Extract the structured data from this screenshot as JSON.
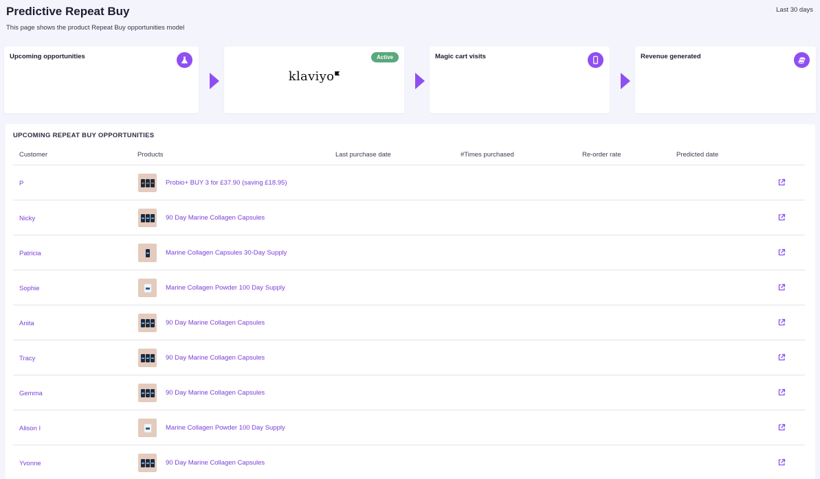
{
  "header": {
    "title": "Predictive Repeat Buy",
    "subtitle": "This page shows the product Repeat Buy opportunities model",
    "date_range": "Last 30 days"
  },
  "cards": [
    {
      "label": "Upcoming opportunities",
      "icon": "flask-icon"
    },
    {
      "logo": "klaviyo",
      "status": "Active",
      "status_color": "#5aa87c"
    },
    {
      "label": "Magic cart visits",
      "icon": "mobile-icon"
    },
    {
      "label": "Revenue generated",
      "icon": "coins-icon"
    }
  ],
  "accent_color": "#8f4ff0",
  "table": {
    "title": "UPCOMING REPEAT BUY OPPORTUNITIES",
    "columns": [
      "Customer",
      "Products",
      "Last purchase date",
      "#Times purchased",
      "Re-order rate",
      "Predicted date"
    ],
    "rows": [
      {
        "customer": "P",
        "product": "Probio+ BUY 3 for £37.90 (saving £18.95)",
        "thumb": "three-dark-jars"
      },
      {
        "customer": "Nicky",
        "product": "90 Day Marine Collagen Capsules",
        "thumb": "three-jars"
      },
      {
        "customer": "Patricia",
        "product": "Marine Collagen Capsules 30-Day Supply",
        "thumb": "single-jar"
      },
      {
        "customer": "Sophie",
        "product": "Marine Collagen Powder 100 Day Supply",
        "thumb": "tub"
      },
      {
        "customer": "Anita",
        "product": "90 Day Marine Collagen Capsules",
        "thumb": "three-jars"
      },
      {
        "customer": "Tracy",
        "product": "90 Day Marine Collagen Capsules",
        "thumb": "three-jars"
      },
      {
        "customer": "Gemma",
        "product": "90 Day Marine Collagen Capsules",
        "thumb": "three-jars"
      },
      {
        "customer": "Alison I",
        "product": "Marine Collagen Powder 100 Day Supply",
        "thumb": "tub"
      },
      {
        "customer": "Yvonne",
        "product": "90 Day Marine Collagen Capsules",
        "thumb": "three-jars"
      }
    ]
  }
}
